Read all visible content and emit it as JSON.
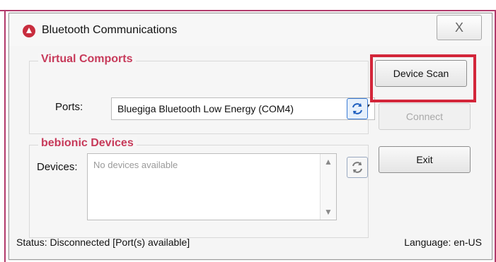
{
  "window": {
    "title": "Bluetooth Communications",
    "close_label": "X"
  },
  "virtual_comports": {
    "group_title": "Virtual Comports",
    "ports_label": "Ports:",
    "ports_selected": "Bluegiga Bluetooth Low Energy (COM4)"
  },
  "bebionic_devices": {
    "group_title": "bebionic Devices",
    "devices_label": "Devices:",
    "devices_placeholder": "No devices available"
  },
  "buttons": {
    "device_scan": "Device Scan",
    "connect": "Connect",
    "exit": "Exit"
  },
  "status_bar": {
    "status": "Status: Disconnected [Port(s) available]",
    "language": "Language: en-US"
  },
  "colors": {
    "accent_red": "#d3263a",
    "group_title": "#c73a5a",
    "pink_frame": "#b23a6b",
    "refresh_blue": "#3a7bd5"
  },
  "icons": {
    "app": "bluetooth-communications-app-icon",
    "refresh_ports": "refresh-arrows-icon",
    "refresh_devices": "refresh-arrows-icon"
  }
}
